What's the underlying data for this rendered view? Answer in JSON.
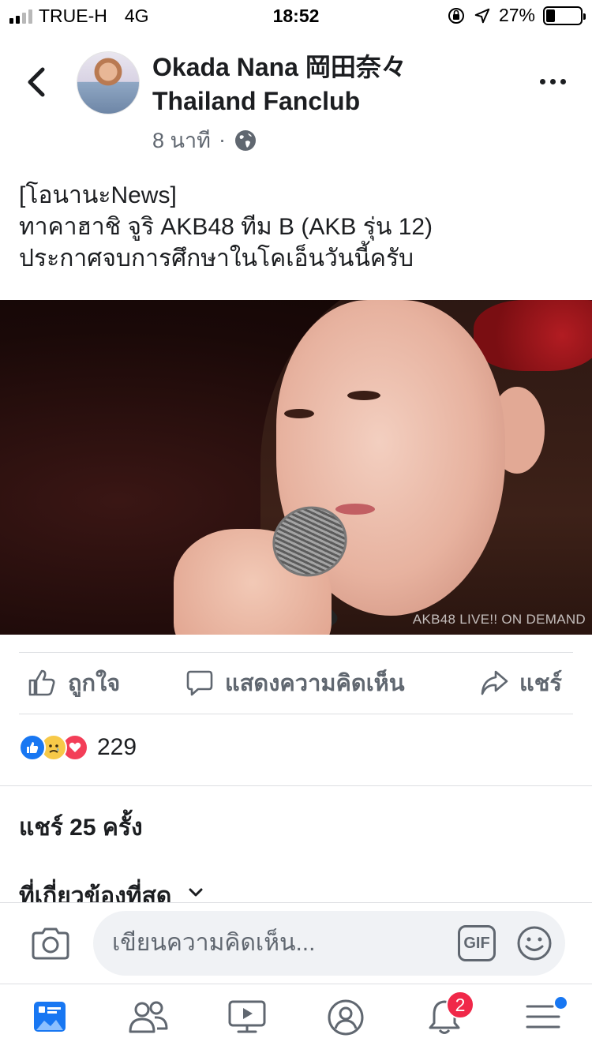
{
  "status_bar": {
    "carrier": "TRUE-H",
    "network": "4G",
    "time": "18:52",
    "battery": "27%",
    "battery_level": 0.27
  },
  "header": {
    "page_name": "Okada Nana 岡田奈々 Thailand Fanclub",
    "time_ago": "8 นาที",
    "separator": "·",
    "audience_icon": "globe-icon"
  },
  "post": {
    "lines": [
      "[โอนานะNews]",
      "ทาคาฮาชิ จูริ AKB48 ทีม B (AKB รุ่น 12)",
      "ประกาศจบการศึกษาในโคเอ็นวันนี้ครับ"
    ],
    "image_watermark": "AKB48 LIVE!! ON DEMAND"
  },
  "actions": {
    "like": "ถูกใจ",
    "comment": "แสดงความคิดเห็น",
    "share": "แชร์"
  },
  "reactions": {
    "types": [
      "like",
      "sad",
      "love"
    ],
    "count": "229"
  },
  "shares_text": "แชร์ 25 ครั้ง",
  "sort_label": "ที่เกี่ยวข้องที่สุด",
  "comment_box": {
    "placeholder": "เขียนความคิดเห็น...",
    "gif_label": "GIF"
  },
  "tab_bar": {
    "items": [
      "news-feed",
      "friends",
      "watch",
      "profile",
      "notifications",
      "menu"
    ],
    "notifications_badge": "2"
  },
  "colors": {
    "brand_blue": "#1877f2",
    "text_primary": "#1c1e21",
    "text_secondary": "#606770",
    "badge_red": "#f02849"
  }
}
